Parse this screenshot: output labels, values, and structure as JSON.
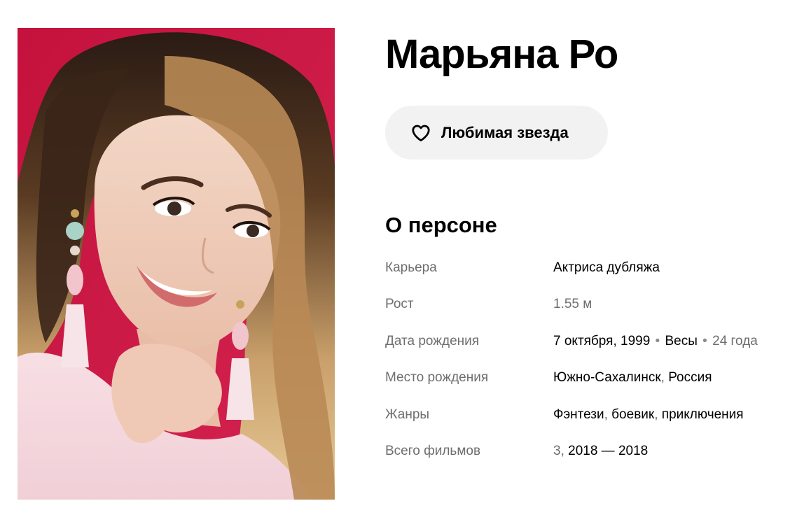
{
  "person": {
    "name": "Марьяна Ро"
  },
  "favorite_button": {
    "label": "Любимая звезда",
    "icon": "heart-outline-icon"
  },
  "about": {
    "title": "О персоне",
    "career": {
      "label": "Карьера",
      "value": "Актриса дубляжа"
    },
    "height": {
      "label": "Рост",
      "value": "1.55 м"
    },
    "birth_date": {
      "label": "Дата рождения",
      "date": "7 октября, 1999",
      "zodiac": "Весы",
      "age": "24 года"
    },
    "birth_place": {
      "label": "Место рождения",
      "city": "Южно-Сахалинск",
      "country": "Россия"
    },
    "genres": {
      "label": "Жанры",
      "items": [
        "Фэнтези",
        "боевик",
        "приключения"
      ]
    },
    "total_films": {
      "label": "Всего фильмов",
      "count": "3",
      "years": "2018 — 2018"
    }
  },
  "colors": {
    "button_bg": "#f2f2f2",
    "photo_bg": "#c8163f",
    "label_gray": "#6e6e6e"
  }
}
